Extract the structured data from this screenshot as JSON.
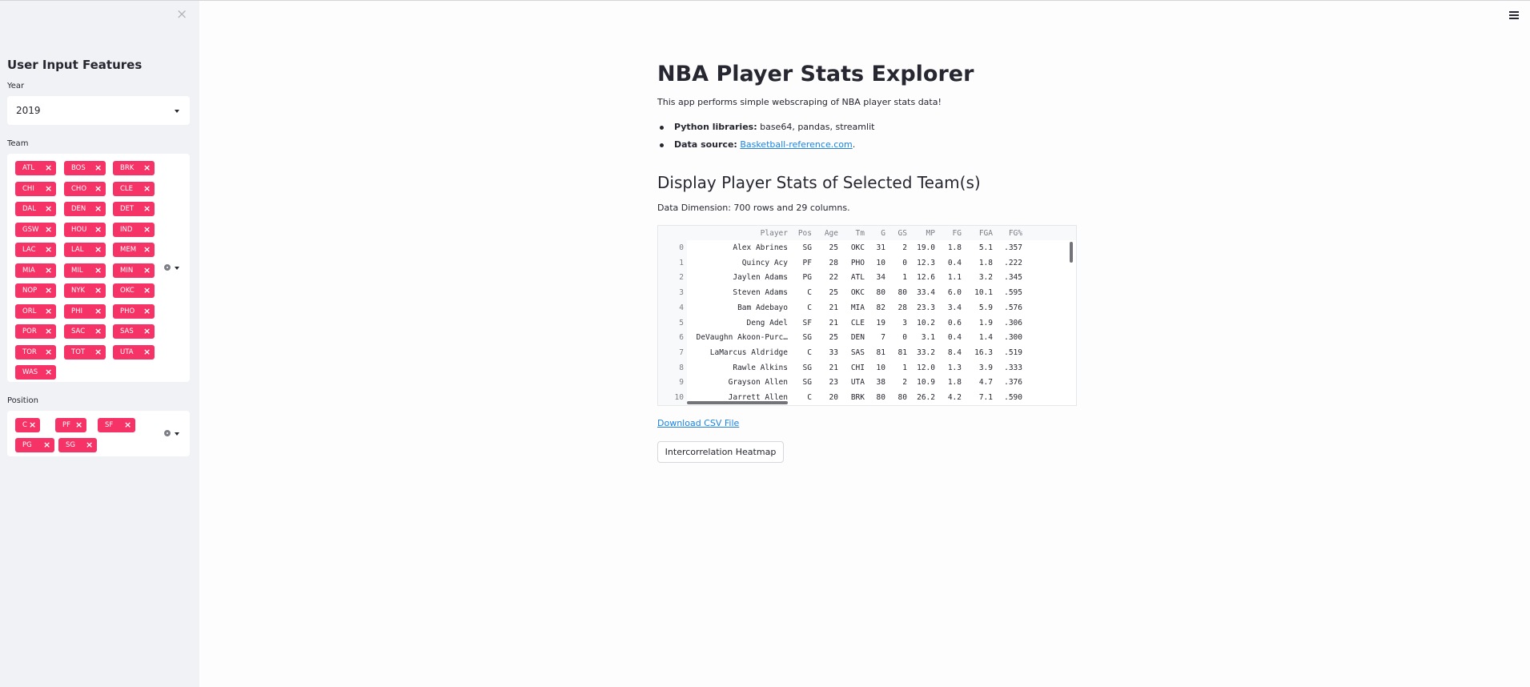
{
  "sidebar": {
    "close_icon": "close-icon",
    "title": "User Input Features",
    "year": {
      "label": "Year",
      "value": "2019"
    },
    "team": {
      "label": "Team",
      "selected": [
        "ATL",
        "BOS",
        "BRK",
        "CHI",
        "CHO",
        "CLE",
        "DAL",
        "DEN",
        "DET",
        "GSW",
        "HOU",
        "IND",
        "LAC",
        "LAL",
        "MEM",
        "MIA",
        "MIL",
        "MIN",
        "NOP",
        "NYK",
        "OKC",
        "ORL",
        "PHI",
        "PHO",
        "POR",
        "SAC",
        "SAS",
        "TOR",
        "TOT",
        "UTA",
        "WAS"
      ]
    },
    "position": {
      "label": "Position",
      "selected": [
        "C",
        "PF",
        "SF",
        "PG",
        "SG"
      ]
    }
  },
  "main": {
    "menu_icon": "hamburger-menu-icon",
    "title": "NBA Player Stats Explorer",
    "intro": "This app performs simple webscraping of NBA player stats data!",
    "bullets": [
      {
        "label": "Python libraries:",
        "text": " base64, pandas, streamlit"
      },
      {
        "label": "Data source:",
        "link": "Basketball-reference.com",
        "suffix": "."
      }
    ],
    "section_title": "Display Player Stats of Selected Team(s)",
    "dimension": "Data Dimension: 700 rows and 29 columns.",
    "table": {
      "columns": [
        "Player",
        "Pos",
        "Age",
        "Tm",
        "G",
        "GS",
        "MP",
        "FG",
        "FGA",
        "FG%"
      ],
      "rows": [
        [
          "0",
          "Álex Abrines",
          "SG",
          "25",
          "OKC",
          "31",
          "2",
          "19.0",
          "1.8",
          "5.1",
          ".357"
        ],
        [
          "1",
          "Quincy Acy",
          "PF",
          "28",
          "PHO",
          "10",
          "0",
          "12.3",
          "0.4",
          "1.8",
          ".222"
        ],
        [
          "2",
          "Jaylen Adams",
          "PG",
          "22",
          "ATL",
          "34",
          "1",
          "12.6",
          "1.1",
          "3.2",
          ".345"
        ],
        [
          "3",
          "Steven Adams",
          "C",
          "25",
          "OKC",
          "80",
          "80",
          "33.4",
          "6.0",
          "10.1",
          ".595"
        ],
        [
          "4",
          "Bam Adebayo",
          "C",
          "21",
          "MIA",
          "82",
          "28",
          "23.3",
          "3.4",
          "5.9",
          ".576"
        ],
        [
          "5",
          "Deng Adel",
          "SF",
          "21",
          "CLE",
          "19",
          "3",
          "10.2",
          "0.6",
          "1.9",
          ".306"
        ],
        [
          "6",
          "DeVaughn Akoon-Purc…",
          "SG",
          "25",
          "DEN",
          "7",
          "0",
          "3.1",
          "0.4",
          "1.4",
          ".300"
        ],
        [
          "7",
          "LaMarcus Aldridge",
          "C",
          "33",
          "SAS",
          "81",
          "81",
          "33.2",
          "8.4",
          "16.3",
          ".519"
        ],
        [
          "8",
          "Rawle Alkins",
          "SG",
          "21",
          "CHI",
          "10",
          "1",
          "12.0",
          "1.3",
          "3.9",
          ".333"
        ],
        [
          "9",
          "Grayson Allen",
          "SG",
          "23",
          "UTA",
          "38",
          "2",
          "10.9",
          "1.8",
          "4.7",
          ".376"
        ],
        [
          "10",
          "Jarrett Allen",
          "C",
          "20",
          "BRK",
          "80",
          "80",
          "26.2",
          "4.2",
          "7.1",
          ".590"
        ]
      ]
    },
    "download_link": "Download CSV File",
    "heatmap_button": "Intercorrelation Heatmap"
  }
}
